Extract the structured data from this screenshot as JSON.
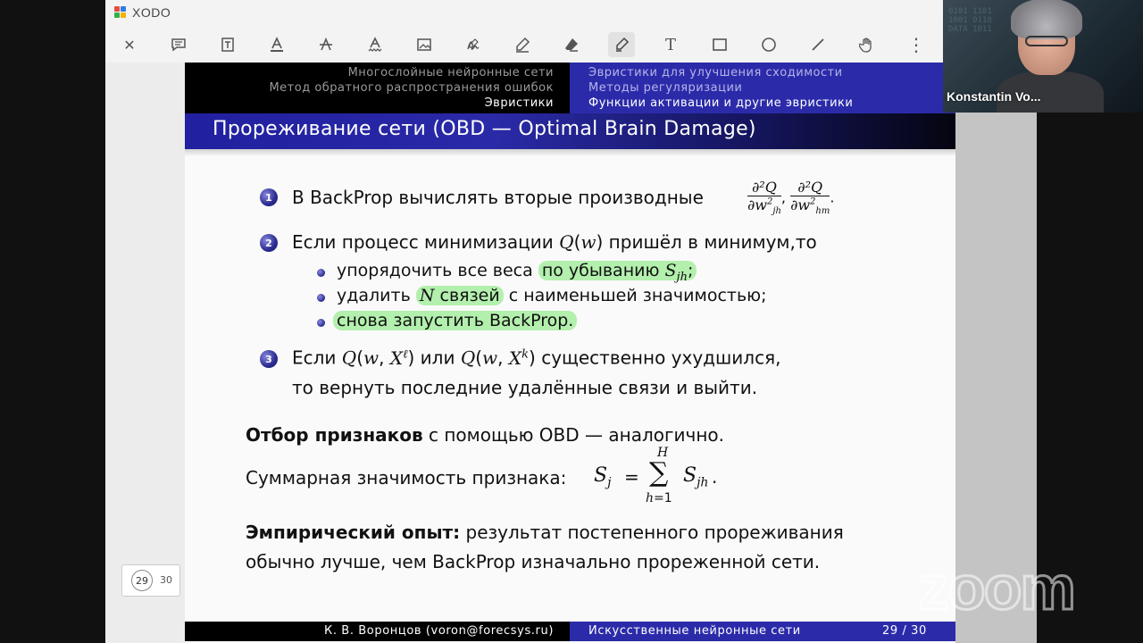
{
  "app": {
    "name": "XODO"
  },
  "toolbar": {
    "tools": [
      {
        "name": "close",
        "glyph": "✕"
      },
      {
        "name": "comment",
        "glyph": ""
      },
      {
        "name": "freetext-box",
        "glyph": ""
      },
      {
        "name": "underline",
        "glyph": "A"
      },
      {
        "name": "strikeout",
        "glyph": "A"
      },
      {
        "name": "squiggly",
        "glyph": "A"
      },
      {
        "name": "image",
        "glyph": ""
      },
      {
        "name": "signature",
        "glyph": ""
      },
      {
        "name": "pen",
        "glyph": ""
      },
      {
        "name": "eraser",
        "glyph": ""
      },
      {
        "name": "highlighter",
        "glyph": ""
      },
      {
        "name": "text",
        "glyph": "T"
      },
      {
        "name": "rectangle",
        "glyph": ""
      },
      {
        "name": "ellipse",
        "glyph": ""
      },
      {
        "name": "line",
        "glyph": ""
      },
      {
        "name": "pan",
        "glyph": ""
      },
      {
        "name": "more",
        "glyph": "⋮"
      }
    ]
  },
  "pager": {
    "current": "29",
    "total": "30"
  },
  "slide": {
    "header_left": [
      "Многослойные нейронные сети",
      "Метод обратного распространения ошибок",
      "Эвристики"
    ],
    "header_right": [
      "Эвристики для улучшения сходимости",
      "Методы регуляризации",
      "Функции активации и другие эвристики"
    ],
    "title": "Прореживание сети (OBD — Optimal Brain Damage)",
    "item1": {
      "num": "1",
      "text": "В BackProp вычислять вторые производные"
    },
    "item2": {
      "num": "2",
      "text_a": "Если процесс минимизации ",
      "text_b": " пришёл в минимум,то"
    },
    "sub1": {
      "a": "упорядочить все веса ",
      "b": "по убыванию "
    },
    "sub2": {
      "a": "удалить ",
      "b": " связей",
      "c": " с наименьшей значимостью;"
    },
    "sub3": {
      "a": "снова запустить BackProp"
    },
    "item3": {
      "num": "3",
      "a": "Если ",
      "b": " или ",
      "c": " существенно ухудшился,",
      "d": "то вернуть последние удалённые связи и выйти."
    },
    "feature": {
      "bold": "Отбор признаков",
      "rest": " с помощью OBD — аналогично."
    },
    "sum": {
      "text": "Суммарная значимость признака: "
    },
    "empiric": {
      "bold": "Эмпирический опыт:",
      "rest": " результат постепенного прореживания",
      "line2": "обычно лучше, чем BackProp изначально прореженной сети."
    },
    "footer_left": "К. В. Воронцов (voron@forecsys.ru)",
    "footer_right": "Искусственные нейронные сети",
    "footer_page": "29 / 30"
  },
  "video": {
    "participant": "Konstantin Vo..."
  },
  "watermark": "zoom"
}
